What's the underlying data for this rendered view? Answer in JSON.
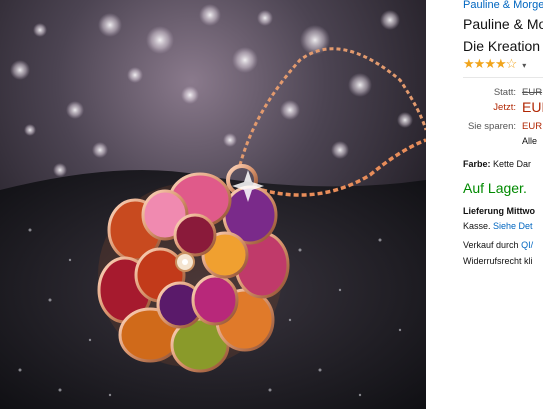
{
  "product": {
    "brand_link": "Pauline & Morge",
    "title_line1": "Pauline & Mo",
    "title_line2": "Die Kreation",
    "rating_stars": 4,
    "rating_caret": "▾"
  },
  "price": {
    "list_label": "Statt:",
    "list_value": "EUR",
    "now_label": "Jetzt:",
    "now_value": "EUR",
    "savings_label": "Sie sparen:",
    "savings_value": "EUR",
    "note": "Alle"
  },
  "color": {
    "label": "Farbe:",
    "value": "Kette Dar"
  },
  "stock": "Auf Lager.",
  "delivery": {
    "line1_bold": "Lieferung Mittwo",
    "line2_text": "Kasse.",
    "line2_link": "Siehe Det"
  },
  "seller": {
    "line1_text": "Verkauf durch",
    "line1_link": "QI/",
    "line2_text": "Widerrufsrecht kli"
  },
  "colors": {
    "link": "#0066c0",
    "price_red": "#b12704",
    "in_stock": "#008a00",
    "star": "#f0a41c"
  }
}
